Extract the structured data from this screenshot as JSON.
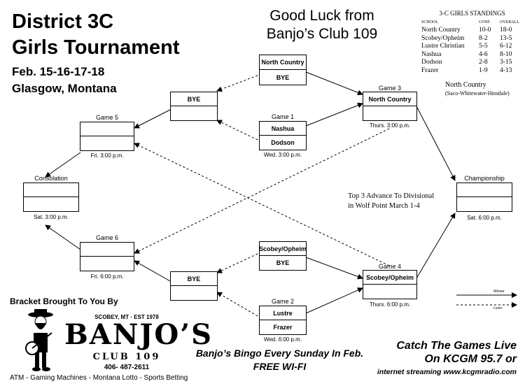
{
  "header": {
    "title_line1": "District 3C",
    "title_line2": "Girls Tournament",
    "dates": "Feb. 15-16-17-18",
    "location": "Glasgow, Montana",
    "sponsor_line1": "Good Luck from",
    "sponsor_line2": "Banjo’s Club 109"
  },
  "standings": {
    "title": "3-C GIRLS STANDINGS",
    "col_school": "SCHOOL",
    "col_conf": "CONF.",
    "col_overall": "OVERALL",
    "rows": [
      {
        "school": "North Country",
        "conf": "10-0",
        "overall": "18-0"
      },
      {
        "school": "Scobey/Opheim",
        "conf": "8-2",
        "overall": "13-5"
      },
      {
        "school": "Lustre Christian",
        "conf": "5-5",
        "overall": "6-12"
      },
      {
        "school": "Nashua",
        "conf": "4-6",
        "overall": "8-10"
      },
      {
        "school": "Dodson",
        "conf": "2-8",
        "overall": "3-15"
      },
      {
        "school": "Frazer",
        "conf": "1-9",
        "overall": "4-13"
      }
    ]
  },
  "north_country_note": {
    "line1": "North Country",
    "line2": "(Saco-Whitewater-Hinsdale)"
  },
  "advance_note": {
    "line1": "Top 3 Advance To Divisional",
    "line2": "in Wolf Point March 1-4"
  },
  "bracket": {
    "bye_nc": {
      "top": "North Country",
      "bottom": "BYE"
    },
    "bye_upper": {
      "top": "BYE",
      "bottom": ""
    },
    "game1": {
      "label": "Game 1",
      "top": "Nashua",
      "bottom": "Dodson",
      "time": "Wed. 3:00 p.m."
    },
    "game3": {
      "label": "Game 3",
      "top": "North Country",
      "bottom": "",
      "time": "Thurs. 3:00 p.m."
    },
    "game5": {
      "label": "Game 5",
      "top": "",
      "bottom": "",
      "time": "Fri. 3:00 p.m."
    },
    "consolation": {
      "label": "Consolation",
      "top": "",
      "bottom": "",
      "time": "Sat. 3:00 p.m."
    },
    "championship": {
      "label": "Championship",
      "top": "",
      "bottom": "",
      "time": "Sat. 6:00 p.m."
    },
    "game6": {
      "label": "Game 6",
      "top": "",
      "bottom": "",
      "time": "Fri. 6:00 p.m."
    },
    "bye_so": {
      "top": "Scobey/Opheim",
      "bottom": "BYE"
    },
    "bye_lower": {
      "top": "BYE",
      "bottom": ""
    },
    "game2": {
      "label": "Game 2",
      "top": "Lustre",
      "bottom": "Frazer",
      "time": "Wed. 6:00  p.m."
    },
    "game4": {
      "label": "Game 4",
      "top": "Scobey/Opheim",
      "bottom": "",
      "time": "Thurs. 6:00 p.m."
    }
  },
  "legend": {
    "winner": "Winner",
    "loser": "Loser"
  },
  "footer": {
    "brought_by": "Bracket Brought To You By",
    "logo_top": "SCOBEY, MT · EST 1978",
    "logo_name": "BANJO’S",
    "logo_club": "CLUB 109",
    "phone": "406- 487-2611",
    "services": "ATM - Gaming Machines - Montana Lotto -  Sports Betting",
    "bingo": "Banjo’s Bingo Every Sunday In Feb.",
    "wifi": "FREE WI-FI",
    "catch_line1": "Catch The Games Live",
    "catch_line2": "On KCGM 95.7 or",
    "streaming": "internet streaming  www.kcgmradio.com"
  }
}
